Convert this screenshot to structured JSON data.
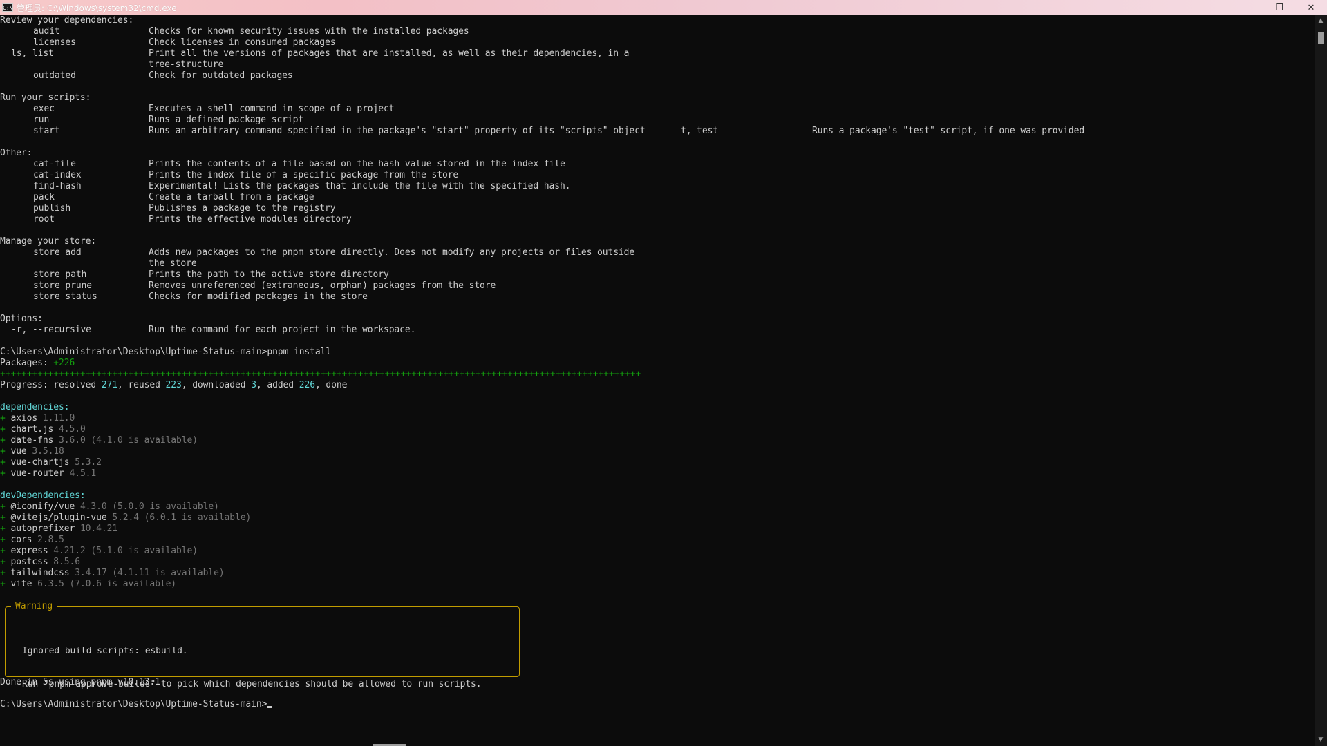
{
  "window": {
    "title_prefix": "管理员: ",
    "title_path": "C:\\Windows\\system32\\cmd.exe",
    "icon_label": "C:\\",
    "controls": {
      "minimize": "—",
      "restore": "❐",
      "close": "✕"
    }
  },
  "help": {
    "review": {
      "heading": "Review your dependencies:",
      "items": [
        {
          "cmd": "audit",
          "desc": "Checks for known security issues with the installed packages"
        },
        {
          "cmd": "licenses",
          "desc": "Check licenses in consumed packages"
        },
        {
          "cmd": "ls, list",
          "desc": "Print all the versions of packages that are installed, as well as their dependencies, in a"
        },
        {
          "cmd": "",
          "desc": "tree-structure"
        },
        {
          "cmd": "outdated",
          "desc": "Check for outdated packages"
        }
      ]
    },
    "scripts": {
      "heading": "Run your scripts:",
      "items": [
        {
          "cmd": "exec",
          "desc": "Executes a shell command in scope of a project"
        },
        {
          "cmd": "run",
          "desc": "Runs a defined package script"
        },
        {
          "cmd": "start",
          "desc": "Runs an arbitrary command specified in the package's \"start\" property of its \"scripts\" object"
        }
      ],
      "wrap_cmd": "t, test",
      "wrap_desc": "Runs a package's \"test\" script, if one was provided"
    },
    "other": {
      "heading": "Other:",
      "items": [
        {
          "cmd": "cat-file",
          "desc": "Prints the contents of a file based on the hash value stored in the index file"
        },
        {
          "cmd": "cat-index",
          "desc": "Prints the index file of a specific package from the store"
        },
        {
          "cmd": "find-hash",
          "desc": "Experimental! Lists the packages that include the file with the specified hash."
        },
        {
          "cmd": "pack",
          "desc": "Create a tarball from a package"
        },
        {
          "cmd": "publish",
          "desc": "Publishes a package to the registry"
        },
        {
          "cmd": "root",
          "desc": "Prints the effective modules directory"
        }
      ]
    },
    "store": {
      "heading": "Manage your store:",
      "items": [
        {
          "cmd": "store add",
          "desc": "Adds new packages to the pnpm store directly. Does not modify any projects or files outside"
        },
        {
          "cmd": "",
          "desc": "the store"
        },
        {
          "cmd": "store path",
          "desc": "Prints the path to the active store directory"
        },
        {
          "cmd": "store prune",
          "desc": "Removes unreferenced (extraneous, orphan) packages from the store"
        },
        {
          "cmd": "store status",
          "desc": "Checks for modified packages in the store"
        }
      ]
    },
    "options": {
      "heading": "Options:",
      "items": [
        {
          "cmd": "-r, --recursive",
          "desc": "Run the command for each project in the workspace."
        }
      ]
    }
  },
  "install": {
    "prompt": "C:\\Users\\Administrator\\Desktop\\Uptime-Status-main>",
    "command": "pnpm install",
    "packages_label": "Packages: ",
    "packages_value": "+226",
    "progress_bar": "++++++++++++++++++++++++++++++++++++++++++++++++++++++++++++++++++++++++++++++++++++++++++++++++++++++++++++++++++++++++",
    "progress": {
      "prefix": "Progress: resolved ",
      "resolved": "271",
      "sep1": ", reused ",
      "reused": "223",
      "sep2": ", downloaded ",
      "downloaded": "3",
      "sep3": ", added ",
      "added": "226",
      "suffix": ", done"
    },
    "dependencies_heading": "dependencies:",
    "dependencies": [
      {
        "name": "axios",
        "version": "1.11.0"
      },
      {
        "name": "chart.js",
        "version": "4.5.0"
      },
      {
        "name": "date-fns",
        "version": "3.6.0 (4.1.0 is available)"
      },
      {
        "name": "vue",
        "version": "3.5.18"
      },
      {
        "name": "vue-chartjs",
        "version": "5.3.2"
      },
      {
        "name": "vue-router",
        "version": "4.5.1"
      }
    ],
    "dev_heading": "devDependencies:",
    "dev_dependencies": [
      {
        "name": "@iconify/vue",
        "version": "4.3.0 (5.0.0 is available)"
      },
      {
        "name": "@vitejs/plugin-vue",
        "version": "5.2.4 (6.0.1 is available)"
      },
      {
        "name": "autoprefixer",
        "version": "10.4.21"
      },
      {
        "name": "cors",
        "version": "2.8.5"
      },
      {
        "name": "express",
        "version": "4.21.2 (5.1.0 is available)"
      },
      {
        "name": "postcss",
        "version": "8.5.6"
      },
      {
        "name": "tailwindcss",
        "version": "3.4.17 (4.1.11 is available)"
      },
      {
        "name": "vite",
        "version": "6.3.5 (7.0.6 is available)"
      }
    ],
    "plus": "+",
    "warning": {
      "title": "Warning",
      "line1": "Ignored build scripts: esbuild.",
      "line2": "Run \"pnpm approve-builds\" to pick which dependencies should be allowed to run scripts."
    },
    "done": "Done in 5s using pnpm v10.13.1",
    "final_prompt": "C:\\Users\\Administrator\\Desktop\\Uptime-Status-main>"
  },
  "colors": {
    "background": "#0c0c0c",
    "foreground": "#cccccc",
    "cyan": "#61d6d6",
    "green": "#13a10e",
    "dim": "#767676",
    "warning": "#c19c00"
  }
}
